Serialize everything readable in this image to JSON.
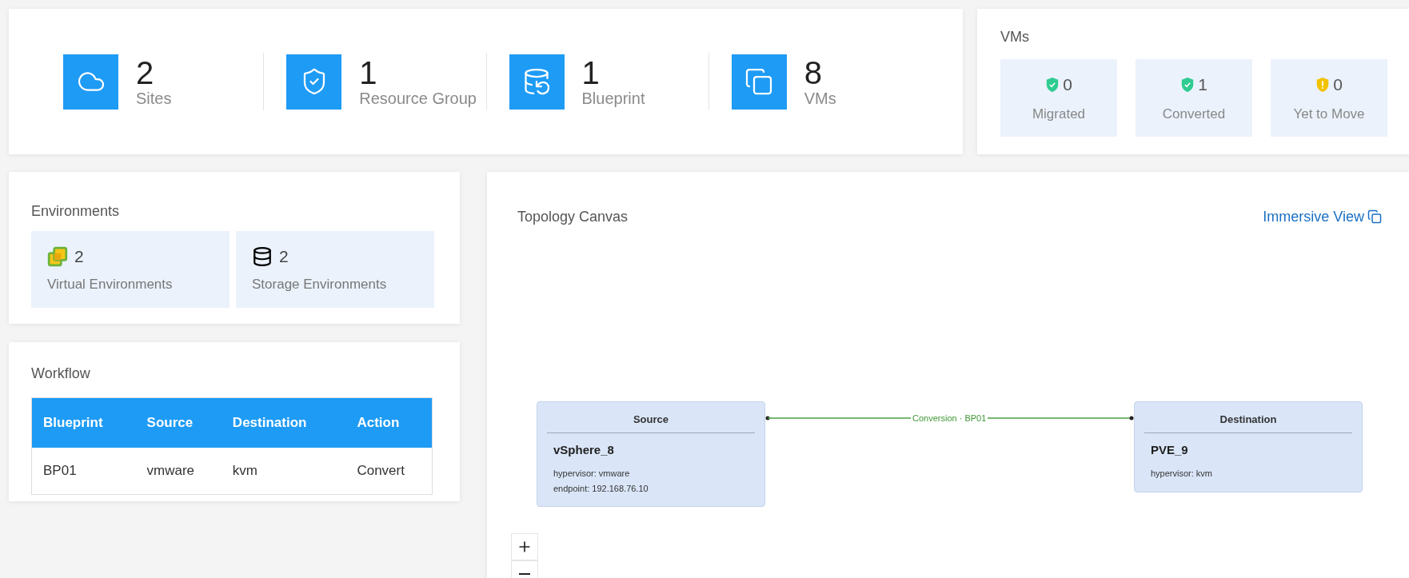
{
  "summary": [
    {
      "kind": "cloud",
      "value": "2",
      "label": "Sites"
    },
    {
      "kind": "shield",
      "value": "1",
      "label": "Resource Group"
    },
    {
      "kind": "blueprint",
      "value": "1",
      "label": "Blueprint"
    },
    {
      "kind": "vms",
      "value": "8",
      "label": "VMs"
    }
  ],
  "vms": {
    "title": "VMs",
    "tiles": [
      {
        "kind": "ok",
        "value": "0",
        "label": "Migrated"
      },
      {
        "kind": "ok",
        "value": "1",
        "label": "Converted"
      },
      {
        "kind": "warning",
        "value": "0",
        "label": "Yet to Move"
      }
    ]
  },
  "environments": {
    "title": "Environments",
    "tiles": [
      {
        "kind": "virtual",
        "value": "2",
        "label": "Virtual Environments"
      },
      {
        "kind": "storage",
        "value": "2",
        "label": "Storage Environments"
      }
    ]
  },
  "workflow": {
    "title": "Workflow",
    "columns": [
      "Blueprint",
      "Source",
      "Destination",
      "Action"
    ],
    "rows": [
      [
        "BP01",
        "vmware",
        "kvm",
        "Convert"
      ]
    ]
  },
  "topology": {
    "title": "Topology Canvas",
    "link": "Immersive View",
    "nodes": [
      {
        "header": "Source",
        "name": "vSphere_8",
        "details": [
          "hypervisor: vmware",
          "endpoint: 192.168.76.10"
        ]
      },
      {
        "header": "Destination",
        "name": "PVE_9",
        "details": [
          "hypervisor: kvm"
        ]
      }
    ],
    "edge": {
      "label": "Conversion · BP01"
    }
  }
}
